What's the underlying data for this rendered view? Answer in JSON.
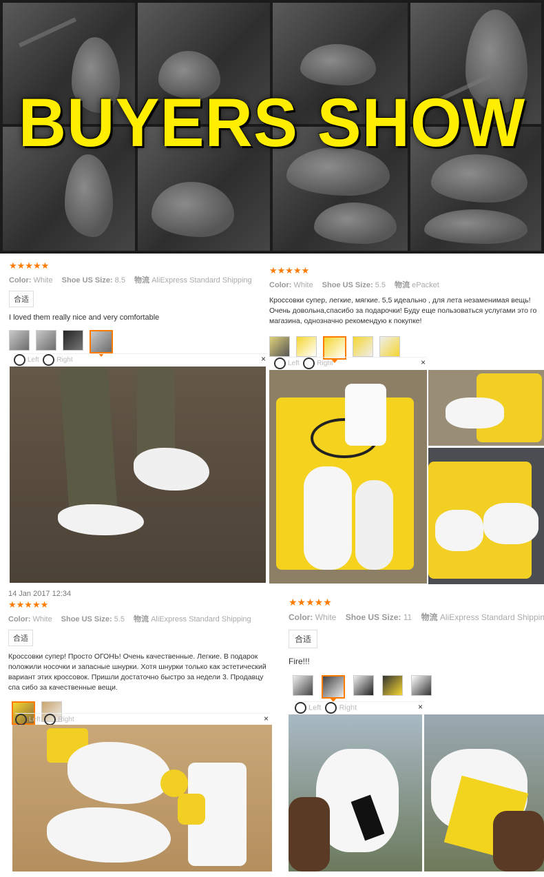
{
  "banner": {
    "title": "BUYERS SHOW"
  },
  "reviews": [
    {
      "stars": "★★★★★",
      "color_label": "Color:",
      "color_value": "White",
      "size_label": "Shoe US Size:",
      "size_value": "8.5",
      "ship_label": "物流",
      "ship_value": "AliExpress Standard Shipping",
      "tag": "合适",
      "text": "I loved them really nice and very comfortable",
      "nav_left": "Left",
      "nav_right": "Right",
      "close": "×"
    },
    {
      "stars": "★★★★★",
      "color_label": "Color:",
      "color_value": "White",
      "size_label": "Shoe US Size:",
      "size_value": "5.5",
      "ship_label": "物流",
      "ship_value": "ePacket",
      "tag": "合适",
      "text": "Кроссовки супер, легкие, мягкие. 5,5 идеально , для лета незаменимая вещь! Очень довольна,спасибо за подарочки! Буду еще пользоваться услугами это го магазина, однозначно рекомендую к покупке!",
      "nav_left": "Left",
      "nav_right": "Right",
      "close": "×"
    },
    {
      "date": "14 Jan 2017 12:34",
      "stars": "★★★★★",
      "color_label": "Color:",
      "color_value": "White",
      "size_label": "Shoe US Size:",
      "size_value": "5.5",
      "ship_label": "物流",
      "ship_value": "AliExpress Standard Shipping",
      "tag": "合适",
      "text": "Кроссовки супер! Просто ОГОНЬ! Очень качественные. Легкие. В подарок положили носочки и запасные шнурки. Хотя шнурки только как эстетический вариант этих кроссовок. Пришли достаточно быстро за недели 3. Продавцу спа сибо за качественные вещи.",
      "nav_left": "Left",
      "nav_right": "Right",
      "close": "×"
    },
    {
      "stars": "★★★★★",
      "color_label": "Color:",
      "color_value": "White",
      "size_label": "Shoe US Size:",
      "size_value": "11",
      "ship_label": "物流",
      "ship_value": "AliExpress Standard Shipping",
      "tag": "合适",
      "text": "Fire!!!",
      "nav_left": "Left",
      "nav_right": "Right",
      "close": "×"
    }
  ],
  "colors": {
    "accent": "#ff7a00",
    "title_yellow": "#ffee00"
  }
}
